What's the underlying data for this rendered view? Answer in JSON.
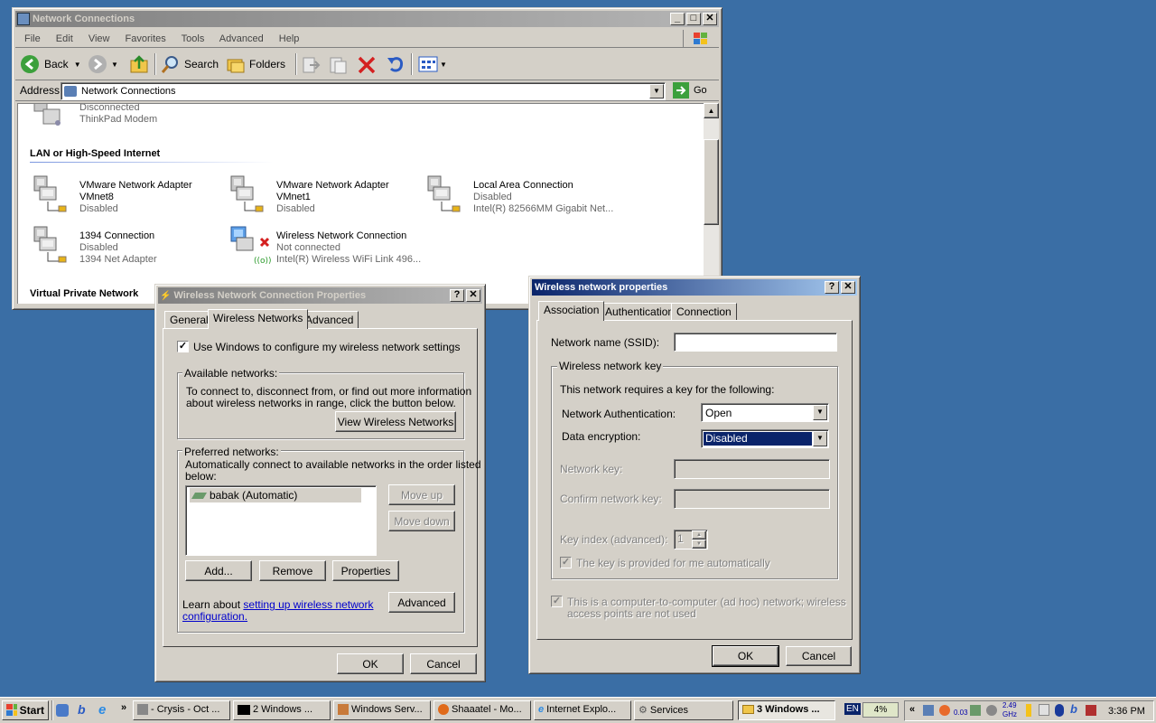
{
  "network_connections": {
    "title": "Network Connections",
    "menu": [
      "File",
      "Edit",
      "View",
      "Favorites",
      "Tools",
      "Advanced",
      "Help"
    ],
    "toolbar": {
      "back": "Back",
      "search": "Search",
      "folders": "Folders"
    },
    "address_label": "Address",
    "address_value": "Network Connections",
    "go_label": "Go",
    "top_item": {
      "status": "Disconnected",
      "device": "ThinkPad Modem"
    },
    "section_lan": "LAN or High-Speed Internet",
    "section_vpn": "Virtual Private Network",
    "items": [
      {
        "name": "VMware Network Adapter VMnet8",
        "status": "Disabled",
        "device": ""
      },
      {
        "name": "VMware Network Adapter VMnet1",
        "status": "Disabled",
        "device": ""
      },
      {
        "name": "Local Area Connection",
        "status": "Disabled",
        "device": "Intel(R) 82566MM Gigabit Net..."
      },
      {
        "name": "1394 Connection",
        "status": "Disabled",
        "device": "1394 Net Adapter"
      },
      {
        "name": "Wireless Network Connection",
        "status": "Not connected",
        "device": "Intel(R) Wireless WiFi Link 496..."
      }
    ],
    "item_names_split": [
      [
        "VMware Network Adapter",
        "VMnet8"
      ],
      [
        "VMware Network Adapter",
        "VMnet1"
      ]
    ]
  },
  "wnc_props": {
    "title": "Wireless Network Connection Properties",
    "tabs": [
      "General",
      "Wireless Networks",
      "Advanced"
    ],
    "use_windows_label": "Use Windows to configure my wireless network settings",
    "available_group": "Available networks:",
    "available_text1": "To connect to, disconnect from, or find out more information",
    "available_text2": "about wireless networks in range, click the button below.",
    "view_wireless_button": "View Wireless Networks",
    "preferred_group": "Preferred networks:",
    "preferred_text1": "Automatically connect to available networks in the order listed",
    "preferred_text2": "below:",
    "preferred_list": [
      "babak (Automatic)"
    ],
    "move_up": "Move up",
    "move_down": "Move down",
    "add": "Add...",
    "remove": "Remove",
    "properties": "Properties",
    "learn_prefix": "Learn about ",
    "learn_link1": "setting up wireless network",
    "learn_link2": "configuration.",
    "advanced": "Advanced",
    "ok": "OK",
    "cancel": "Cancel"
  },
  "wifi_props": {
    "title": "Wireless network properties",
    "tabs": [
      "Association",
      "Authentication",
      "Connection"
    ],
    "ssid_label": "Network name (SSID):",
    "ssid_value": "",
    "key_group": "Wireless network key",
    "key_text": "This network requires a key for the following:",
    "auth_label": "Network Authentication:",
    "auth_value": "Open",
    "enc_label": "Data encryption:",
    "enc_value": "Disabled",
    "netkey_label": "Network key:",
    "confirm_label": "Confirm network key:",
    "keyindex_label": "Key index (advanced):",
    "keyindex_value": "1",
    "auto_key_label": "The key is provided for me automatically",
    "adhoc_label1": "This is a computer-to-computer (ad hoc) network; wireless",
    "adhoc_label2": "access points are not used",
    "ok": "OK",
    "cancel": "Cancel"
  },
  "taskbar": {
    "start": "Start",
    "buttons": [
      "- Crysis - Oct ...",
      "2 Windows ...",
      "Windows Serv...",
      "Shaaatel - Mo...",
      "Internet Explo...",
      "Services",
      "3 Windows ..."
    ],
    "lang": "EN",
    "cpu": "4%",
    "net_speed": "0.03",
    "cpu_freq1": "2.49",
    "cpu_freq2": "GHz",
    "clock": "3:36 PM"
  }
}
